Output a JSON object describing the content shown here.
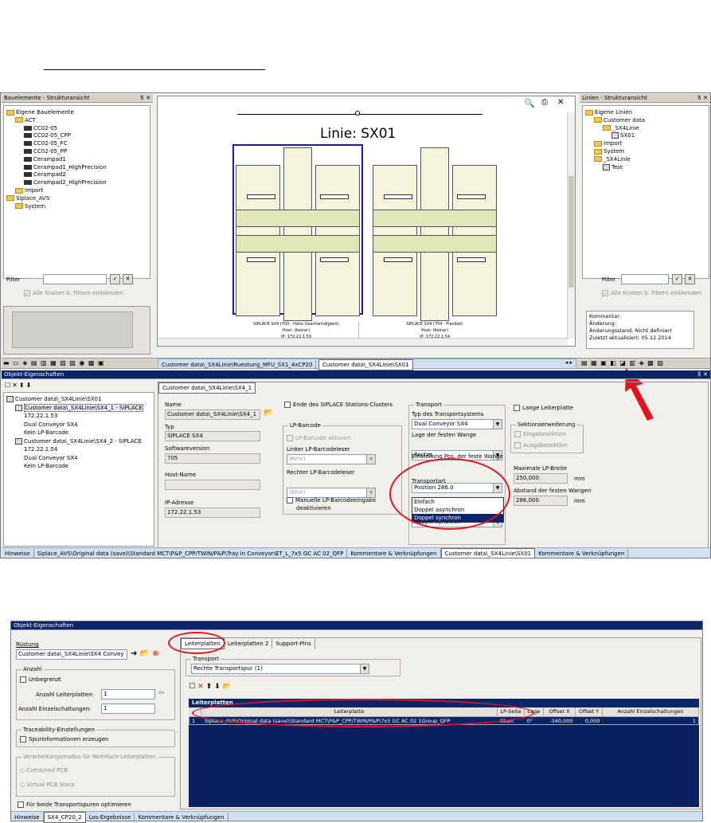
{
  "top_panel": {
    "left_tree_title": "Bauelemente - Strukturansicht",
    "left_tree": [
      {
        "text": "Eigene Bauelemente",
        "type": "folder",
        "indent": 0
      },
      {
        "text": "ACT",
        "type": "folder",
        "indent": 1
      },
      {
        "text": "CC02-05",
        "type": "chip",
        "indent": 2
      },
      {
        "text": "CC02-05_CPP",
        "type": "chip",
        "indent": 2
      },
      {
        "text": "CC02-05_FC",
        "type": "chip",
        "indent": 2
      },
      {
        "text": "CC02-05_PP",
        "type": "chip",
        "indent": 2
      },
      {
        "text": "Cerampad1",
        "type": "chip",
        "indent": 2
      },
      {
        "text": "Cerampad1_HighPrecision",
        "type": "chip",
        "indent": 2
      },
      {
        "text": "Cerampad2",
        "type": "chip",
        "indent": 2
      },
      {
        "text": "Cerampad2_HighPrecision",
        "type": "chip",
        "indent": 2
      },
      {
        "text": "Import",
        "type": "folder",
        "indent": 1
      },
      {
        "text": "Siplace_AVS",
        "type": "folder",
        "indent": 0
      },
      {
        "text": "System",
        "type": "folder",
        "indent": 1
      }
    ],
    "filter_label": "Filter",
    "show_all_label": "Alle Knoten b. Filtern einblenden",
    "canvas_title": "Linie: SX01",
    "station1_caption": "SIPLACE SX4 (703 - Hohe Geschwindigkeit)",
    "station1_host": "Host: (Keiner)",
    "station1_ip": "IP: 172.22.1.53",
    "station2_caption": "SIPLACE SX4 (704 - Flexibel)",
    "station2_host": "Host: (Keiner)",
    "station2_ip": "IP: 172.22.1.54",
    "right_tree_title": "Linien - Strukturansicht",
    "right_tree": [
      {
        "text": "Eigene Linien",
        "type": "folder",
        "indent": 0
      },
      {
        "text": "Customer data",
        "type": "folder",
        "indent": 1
      },
      {
        "text": "_SX4Linie",
        "type": "folder",
        "indent": 2
      },
      {
        "text": "SX01",
        "type": "line",
        "indent": 3
      },
      {
        "text": "Import",
        "type": "folder",
        "indent": 1
      },
      {
        "text": "System",
        "type": "folder",
        "indent": 1
      },
      {
        "text": "_SX4Linie",
        "type": "folder",
        "indent": 1
      },
      {
        "text": "Test",
        "type": "line",
        "indent": 2
      }
    ],
    "right_filter_label": "Filter",
    "right_show_all_label": "Alle Knoten b. Filtern einblenden",
    "comment_lines": [
      "Kommentar:",
      "Änderung:",
      "Änderungsstand: Nicht definiert",
      "Zuletzt aktualisiert: 05.12.2014"
    ],
    "doc_tabs": [
      "Customer data\\_SX4Linie\\Ruestung_MFU_SX1_4xCP20",
      "Customer data\\_SX4Linie\\SX01"
    ]
  },
  "objekt": {
    "title": "Objekt-Eigenschaften",
    "tree": [
      {
        "text": "Customer data\\_SX4Linie\\SX01",
        "indent": 0
      },
      {
        "text": "Customer data\\_SX4Linie\\SX4_1 - SIPLACE",
        "indent": 1,
        "selected": true
      },
      {
        "text": "172.22.1.53",
        "indent": 2
      },
      {
        "text": "Dual Conveyor SX4",
        "indent": 2
      },
      {
        "text": "Kein LP-Barcode",
        "indent": 2
      },
      {
        "text": "Customer data\\_SX4Linie\\SX4_2 - SIPLACE",
        "indent": 1
      },
      {
        "text": "172.22.1.54",
        "indent": 2
      },
      {
        "text": "Dual Conveyor SX4",
        "indent": 2
      },
      {
        "text": "Kein LP-Barcode",
        "indent": 2
      }
    ],
    "tab_label": "Customer data\\_SX4Linie\\SX4_1",
    "name_label": "Name",
    "name_value": "Customer data\\_SX4Linie\\SX4_1",
    "typ_label": "Typ",
    "typ_value": "SIPLACE SX4",
    "sw_label": "Softwareversion",
    "sw_value": "705",
    "host_label": "Host-Name",
    "host_value": "",
    "ip_label": "IP-Adresse",
    "ip_value": "172.22.1.53",
    "ende_label": "Ende des SIPLACE Stations-Clusters",
    "lp_group": "LP-Barcode",
    "lp_aktiv": "LP-Barcode aktiviert",
    "linker_label": "Linker LP-Barcodeleser",
    "linker_value": "(Kein)",
    "rechter_label": "Rechter LP-Barcodeleser",
    "rechter_value": "(Kein)",
    "manuell_line1": "Manuelle LP-Barcodeeingabe",
    "manuell_line2": "deaktivieren",
    "transport_group": "Transport",
    "typ_transport_label": "Typ des Transportsystems",
    "typ_transport_value": "Dual Conveyor SX4",
    "lage_label": "Lage der festen Wange",
    "lage_value": "Rechts",
    "einstellung_label": "Einstellung Pos. der feste Wange",
    "einstellung_value": "Position 286.0",
    "transportart_label": "Transportart",
    "transportart_value": "Doppel synchron",
    "transportart_options": [
      "Einfach",
      "Doppel asynchron",
      "Doppel synchron"
    ],
    "lange_label": "Lange Leiterplatte",
    "sektion_group": "Sektionserweiterung",
    "eingabe_label": "Eingabesektion",
    "ausgabe_label": "Ausgabesektion",
    "max_label": "Maximale LP-Breite",
    "max_value": "250,000",
    "max_unit": "mm",
    "abstand_label": "Abstand der festen Wangen",
    "abstand_value": "286,000",
    "abstand_unit": "mm",
    "status_tabs": [
      "Hinweise",
      "Siplace_AVS\\Original data (save)\\Standard MCT\\P&P_CPP/TWIN/P&P\\Tray in Conveyor\\ET_L_7x5 GC AC 02_QFP",
      "Kommentare & Verknüpfungen",
      "Customer data\\_SX4Linie\\SX01",
      "Kommentare & Verknüpfungen"
    ]
  },
  "bottom": {
    "title": "Objekt-Eigenschaften",
    "ruestung_label": "Rüstung",
    "ruestung_value": "Customer data\\_SX4Linie\\SX4 Convey",
    "anzahl_group": "Anzahl",
    "unbegrenzt_label": "Unbegrenzt",
    "anzahl_lp_label": "Anzahl Leiterplatten:",
    "anzahl_lp_value": "1",
    "anzahl_einzel_label": "Anzahl Einzelschaltungen:",
    "anzahl_einzel_value": "1",
    "trace_group": "Traceability-Einstellungen",
    "spur_label": "Spurinformationen erzeugen",
    "verarb_group": "Verarbeitungsmodus für Mehrfach-Leiterplatten",
    "combined_label": "Combined PCB",
    "virtual_label": "Virtual PCB Stack",
    "beide_label": "Für beide Transportspuren optimieren",
    "tabs": [
      "Leiterplatten",
      "Leiterplatten 2",
      "Support-Pins"
    ],
    "transport_label": "Transport",
    "transport_value": "Rechte Transportspur (1)",
    "grid_title": "Leiterplatten",
    "columns": [
      "",
      "Leiterplatte",
      "LP-Seite",
      "Lage",
      "Offset X",
      "Offset Y",
      "Anzahl Einzelschaltungen"
    ],
    "row": [
      "1",
      "Siplace_AVS\\Original data (save)\\Standard MCT\\P&P_CPP/TWIN/P&P\\7x5 GC AC 02 1Group_QFP",
      "Oben",
      "0°",
      "-340,000",
      "0,000",
      "1"
    ],
    "status_tabs": [
      "Hinweise",
      "SX4_CP20_2",
      "Los-Ergebnisse",
      "Kommentare & Verknüpfungen"
    ]
  },
  "colors": {
    "highlight": "#e0141e",
    "selection": "#0a246a",
    "tab_bar": "#cfe0f2"
  }
}
